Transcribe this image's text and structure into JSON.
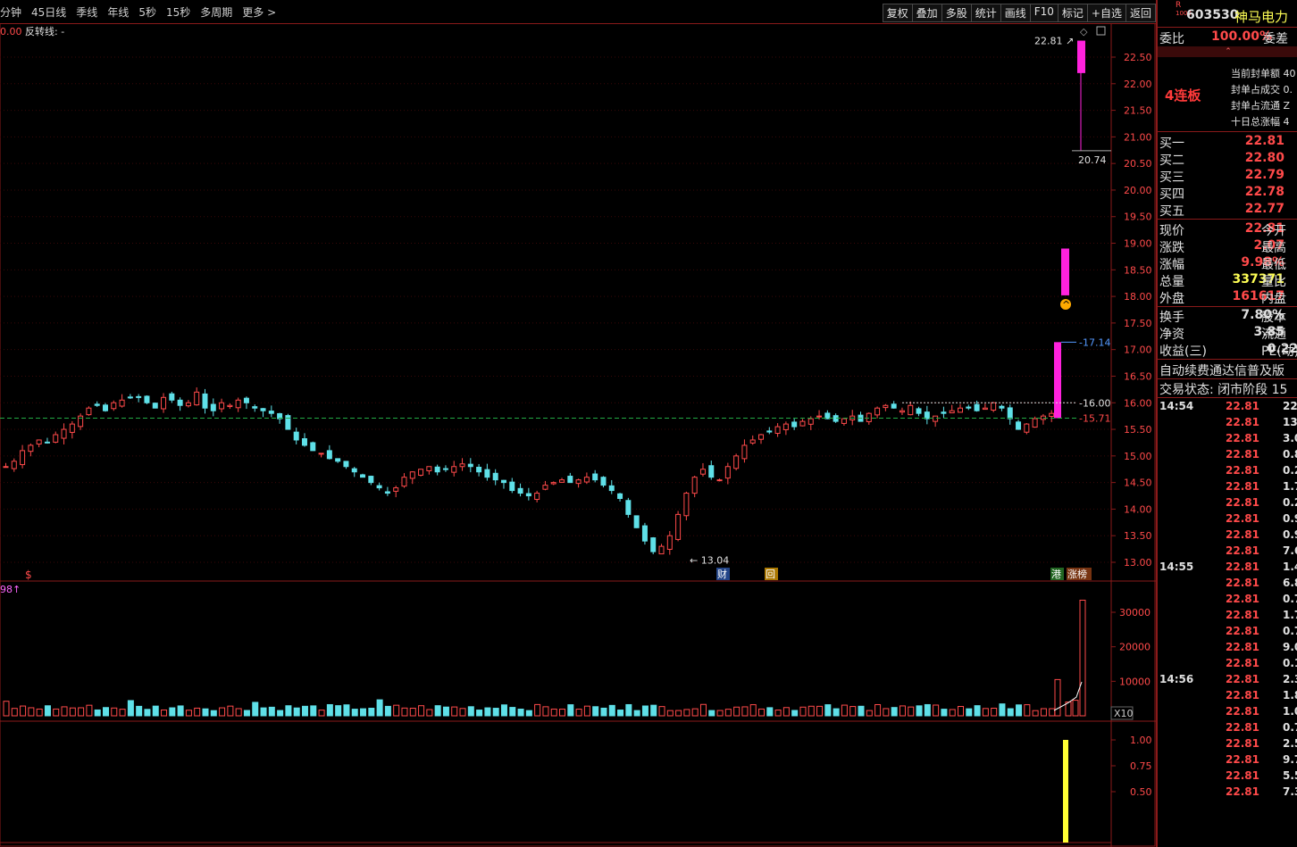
{
  "toolbar": {
    "periods": [
      "分钟",
      "45日线",
      "季线",
      "年线",
      "5秒",
      "15秒",
      "多周期",
      "更多 >"
    ],
    "actions": [
      "复权",
      "叠加",
      "多股",
      "统计",
      "画线",
      "F10",
      "标记",
      "+自选",
      "返回"
    ]
  },
  "chart": {
    "indicator_left": "0.00",
    "indicator_name": "反转线: -",
    "high_label": "22.81",
    "low_label_top": "20.74",
    "low_label_bottom": "13.04",
    "line_label_1": "16.00",
    "line_label_2": "15.71",
    "line_label_3": "17.14",
    "price_ticks": [
      "22.50",
      "22.00",
      "21.50",
      "21.00",
      "20.50",
      "20.00",
      "19.50",
      "19.00",
      "18.50",
      "18.00",
      "17.50",
      "17.00",
      "16.50",
      "16.00",
      "15.50",
      "15.00",
      "14.50",
      "14.00",
      "13.50",
      "13.00"
    ],
    "markers": {
      "dollar": "$",
      "cai": "财",
      "hui": "回",
      "gang": "港",
      "zhangbang": "涨榜"
    },
    "vol_left": "98↑",
    "vol_ticks": [
      "30000",
      "20000",
      "10000"
    ],
    "vol_unit": "X10",
    "ind_ticks": [
      "1.00",
      "0.75",
      "0.50"
    ],
    "colors": {
      "up": "#ff4a4a",
      "down": "#5fe0e8",
      "magenta": "#ff22dd",
      "yellow": "#ffff33",
      "grid": "#8a1a1a"
    }
  },
  "side": {
    "badge": "R",
    "badge_sub": "1000",
    "code": "603530",
    "name": "神马电力",
    "weibi_label": "委比",
    "weibi_value": "100.00%",
    "weicha_label": "委差",
    "lianban": "4连板",
    "seal_info": [
      "当前封单额 40",
      "封单占成交 0.",
      "封单占流通 Z",
      "十日总涨幅 4"
    ],
    "bids": [
      {
        "label": "买一",
        "price": "22.81"
      },
      {
        "label": "买二",
        "price": "22.80"
      },
      {
        "label": "买三",
        "price": "22.79"
      },
      {
        "label": "买四",
        "price": "22.78"
      },
      {
        "label": "买五",
        "price": "22.77"
      }
    ],
    "quote": [
      {
        "label": "现价",
        "value": "22.81",
        "right": "今开"
      },
      {
        "label": "涨跌",
        "value": "2.07",
        "right": "最高"
      },
      {
        "label": "涨幅",
        "value": "9.98%",
        "right": "最低"
      },
      {
        "label": "总量",
        "value": "337371",
        "right": "量比"
      },
      {
        "label": "外盘",
        "value": "161617",
        "right": "内盘"
      }
    ],
    "quote2": [
      {
        "label": "换手",
        "value": "7.80%",
        "right": "股本"
      },
      {
        "label": "净资",
        "value": "3.85",
        "right": "流通"
      },
      {
        "label": "收益(三)",
        "value": "0.220",
        "right": "PE(动)"
      }
    ],
    "banner": "自动续费通达信普及版",
    "trade_state": "交易状态: 闭市阶段 15",
    "ticks": [
      {
        "time": "14:54",
        "price": "22.81",
        "vol": "22."
      },
      {
        "time": "",
        "price": "22.81",
        "vol": "13.2"
      },
      {
        "time": "",
        "price": "22.81",
        "vol": "3.0"
      },
      {
        "time": "",
        "price": "22.81",
        "vol": "0.8"
      },
      {
        "time": "",
        "price": "22.81",
        "vol": "0.2"
      },
      {
        "time": "",
        "price": "22.81",
        "vol": "1.7"
      },
      {
        "time": "",
        "price": "22.81",
        "vol": "0.2"
      },
      {
        "time": "",
        "price": "22.81",
        "vol": "0.9"
      },
      {
        "time": "",
        "price": "22.81",
        "vol": "0.9"
      },
      {
        "time": "",
        "price": "22.81",
        "vol": "7.6"
      },
      {
        "time": "14:55",
        "price": "22.81",
        "vol": "1.4"
      },
      {
        "time": "",
        "price": "22.81",
        "vol": "6.8"
      },
      {
        "time": "",
        "price": "22.81",
        "vol": "0.7"
      },
      {
        "time": "",
        "price": "22.81",
        "vol": "1.7"
      },
      {
        "time": "",
        "price": "22.81",
        "vol": "0.7"
      },
      {
        "time": "",
        "price": "22.81",
        "vol": "9.0"
      },
      {
        "time": "",
        "price": "22.81",
        "vol": "0.1"
      },
      {
        "time": "14:56",
        "price": "22.81",
        "vol": "2.3"
      },
      {
        "time": "",
        "price": "22.81",
        "vol": "1.8"
      },
      {
        "time": "",
        "price": "22.81",
        "vol": "1.0"
      },
      {
        "time": "",
        "price": "22.81",
        "vol": "0.7"
      },
      {
        "time": "",
        "price": "22.81",
        "vol": "2.5"
      },
      {
        "time": "",
        "price": "22.81",
        "vol": "9.7"
      },
      {
        "time": "",
        "price": "22.81",
        "vol": "5.5"
      },
      {
        "time": "",
        "price": "22.81",
        "vol": "7.3"
      }
    ]
  }
}
